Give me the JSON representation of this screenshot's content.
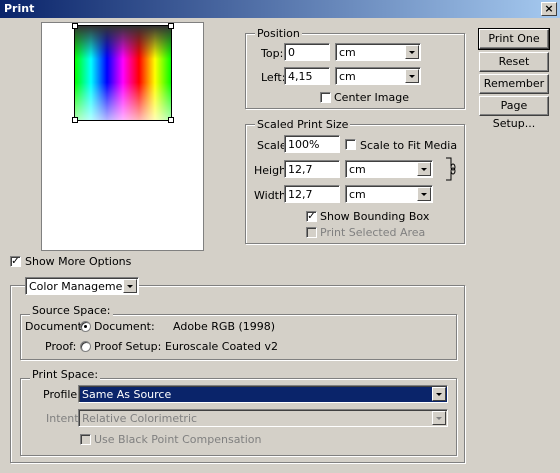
{
  "window": {
    "title": "Print",
    "close_glyph": "×"
  },
  "buttons": {
    "print_one": "Print One",
    "reset": "Reset",
    "remember": "Remember",
    "page_setup": "Page Setup..."
  },
  "position": {
    "legend": "Position",
    "top_label": "Top:",
    "top_value": "0",
    "top_unit": "cm",
    "left_label": "Left:",
    "left_value": "4,15",
    "left_unit": "cm",
    "center_label": "Center Image",
    "center_checked": false
  },
  "scaled": {
    "legend": "Scaled Print Size",
    "scale_label": "Scale:",
    "scale_value": "100%",
    "fit_label": "Scale to Fit Media",
    "fit_checked": false,
    "height_label": "Height:",
    "height_value": "12,7",
    "height_unit": "cm",
    "width_label": "Width:",
    "width_value": "12,7",
    "width_unit": "cm",
    "bbox_label": "Show Bounding Box",
    "bbox_checked": true,
    "selected_label": "Print Selected Area",
    "selected_checked": false
  },
  "more_options": {
    "label": "Show More Options",
    "checked": true,
    "dropdown": "Color Management"
  },
  "source_space": {
    "legend": "Source Space:",
    "document_label": "Document:",
    "document_radio": "Document:",
    "document_value": "Adobe RGB (1998)",
    "proof_label": "Proof:",
    "proof_radio": "Proof Setup:",
    "proof_value": "Euroscale Coated v2"
  },
  "print_space": {
    "legend": "Print Space:",
    "profile_label": "Profile:",
    "profile_value": "Same As Source",
    "intent_label": "Intent:",
    "intent_value": "Relative Colorimetric",
    "bpc_label": "Use Black Point Compensation",
    "bpc_checked": false
  },
  "colors": {
    "titlebar": "#0a246a",
    "face": "#d4d0c8",
    "selection": "#0a246a"
  }
}
